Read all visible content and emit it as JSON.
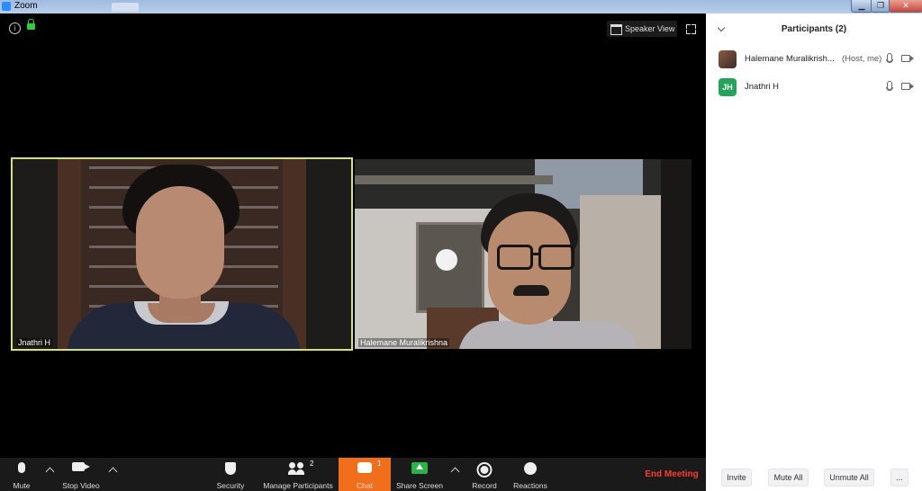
{
  "window": {
    "title": "Zoom",
    "minimize_glyph": "▁",
    "maximize_glyph": "❐",
    "close_glyph": "✕"
  },
  "stage": {
    "info_glyph": "i",
    "speaker_view_label": "Speaker View"
  },
  "tiles": [
    {
      "name": "Jnathri H",
      "active_speaker": true
    },
    {
      "name": "Halemane Muralikrishna",
      "active_speaker": false
    }
  ],
  "toolbar": {
    "mute_label": "Mute",
    "stop_video_label": "Stop Video",
    "security_label": "Security",
    "manage_participants_label": "Manage Participants",
    "participants_count": "2",
    "chat_label": "Chat",
    "chat_badge": "1",
    "share_screen_label": "Share Screen",
    "record_label": "Record",
    "reactions_label": "Reactions",
    "end_meeting_label": "End Meeting"
  },
  "panel": {
    "title": "Participants (2)",
    "participants": [
      {
        "name": "Halemane Muralikrish...",
        "tag": "(Host, me)",
        "avatar": "photo"
      },
      {
        "name": "Jnathri H",
        "tag": "",
        "avatar": "JH"
      }
    ],
    "invite_label": "Invite",
    "mute_all_label": "Mute All",
    "unmute_all_label": "Unmute All",
    "more_label": "..."
  },
  "colors": {
    "accent_chat": "#f16e1c",
    "end_meeting": "#ff3b30",
    "active_speaker_border": "#d3e27d",
    "avatar_jh": "#25a35b",
    "share_green": "#29b34a"
  }
}
